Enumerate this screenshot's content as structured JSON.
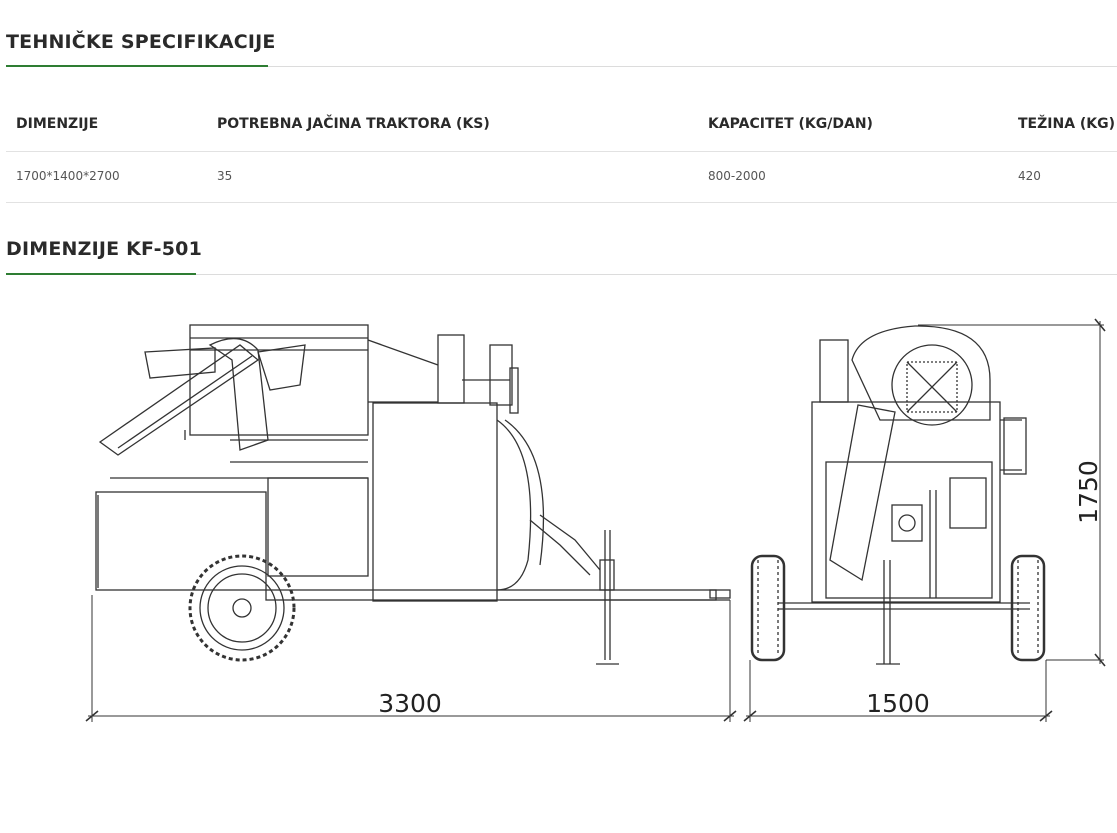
{
  "specs_section": {
    "heading": "TEHNIČKE SPECIFIKACIJE",
    "columns": [
      "DIMENZIJE",
      "POTREBNA JAČINA TRAKTORA (KS)",
      "KAPACITET (KG/DAN)",
      "TEŽINA (KG)"
    ],
    "rows": [
      [
        "1700*1400*2700",
        "35",
        "800-2000",
        "420"
      ]
    ]
  },
  "dimensions_section": {
    "heading": "DIMENZIJE KF-501",
    "length_label": "3300",
    "width_label": "1500",
    "height_label": "1750"
  },
  "colors": {
    "accent": "#2e7d32",
    "divider": "#dcdcdc",
    "line_art": "#333333"
  }
}
